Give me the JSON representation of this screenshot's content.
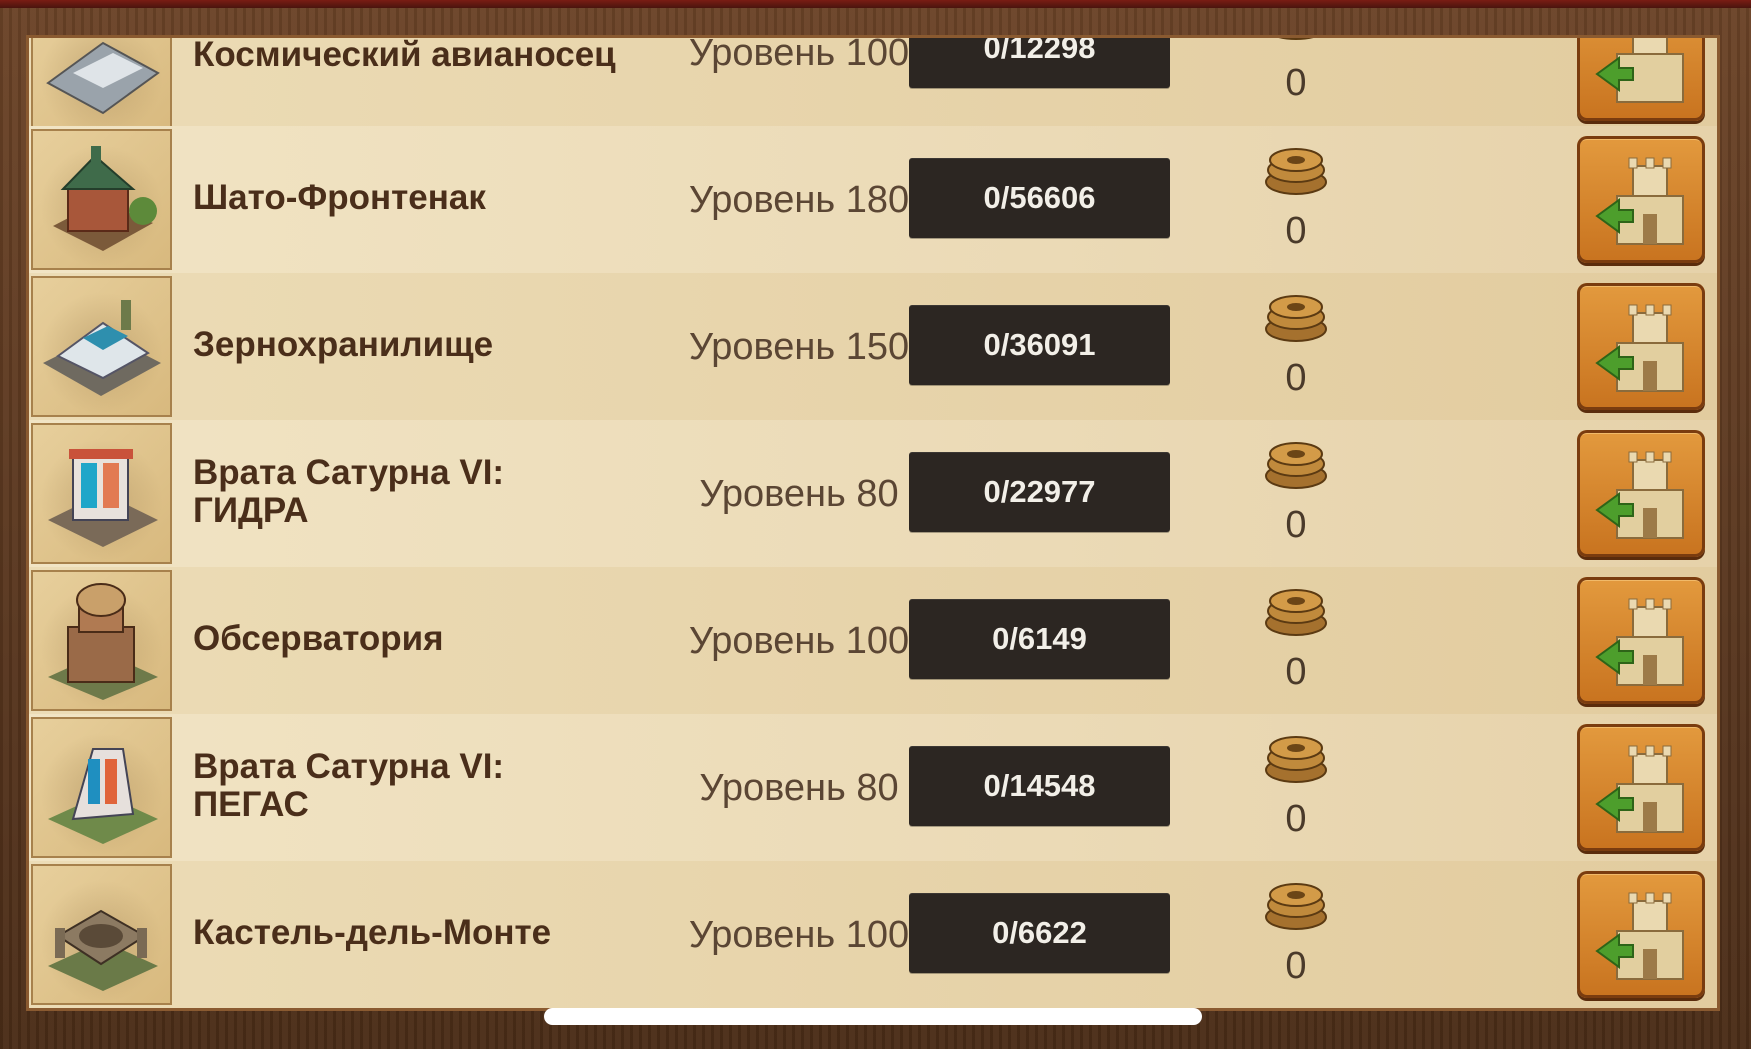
{
  "rows": [
    {
      "name_line1": "Космический авианосец",
      "name_line2": "",
      "level": "Уровень 100",
      "progress": "0/12298",
      "count": "0"
    },
    {
      "name_line1": "Шато-Фронтенак",
      "name_line2": "",
      "level": "Уровень 180",
      "progress": "0/56606",
      "count": "0"
    },
    {
      "name_line1": "Зернохранилище",
      "name_line2": "",
      "level": "Уровень 150",
      "progress": "0/36091",
      "count": "0"
    },
    {
      "name_line1": "Врата Сатурна VI:",
      "name_line2": "ГИДРА",
      "level": "Уровень 80",
      "progress": "0/22977",
      "count": "0"
    },
    {
      "name_line1": "Обсерватория",
      "name_line2": "",
      "level": "Уровень 100",
      "progress": "0/6149",
      "count": "0"
    },
    {
      "name_line1": "Врата Сатурна VI:",
      "name_line2": "ПЕГАС",
      "level": "Уровень 80",
      "progress": "0/14548",
      "count": "0"
    },
    {
      "name_line1": "Кастель-дель-Монте",
      "name_line2": "",
      "level": "Уровень 100",
      "progress": "0/6622",
      "count": "0"
    }
  ],
  "icons": {
    "thumbnail": "building-thumbnail-icon",
    "reward": "forge-points-coin-icon",
    "visit": "visit-city-castle-icon"
  },
  "colors": {
    "accent": "#d9862e",
    "arrow_green": "#4d9e2c",
    "progress_bg": "#2c2622"
  }
}
